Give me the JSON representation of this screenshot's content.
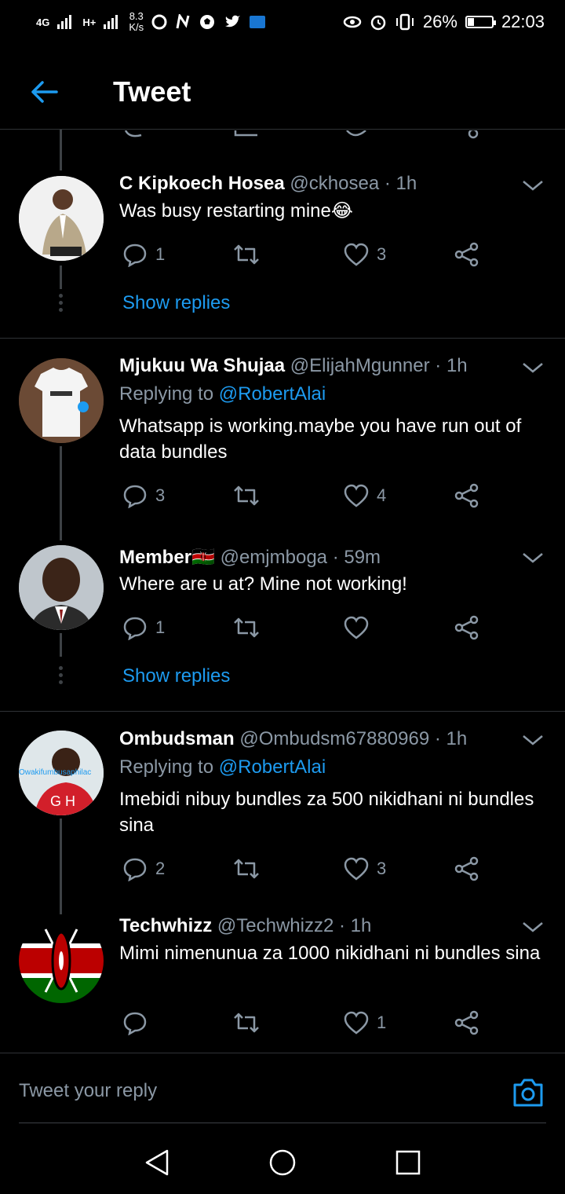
{
  "status_bar": {
    "network_1": "4G",
    "network_2": "H+",
    "speed_value": "8.3",
    "speed_unit": "K/s",
    "battery_percent": "26%",
    "battery_level": 0.26,
    "time": "22:03"
  },
  "header": {
    "title": "Tweet"
  },
  "tweets": [
    {
      "name": "C Kipkoech Hosea",
      "handle": "@ckhosea",
      "sep": "·",
      "time": "1h",
      "text": "Was busy restarting mine😂",
      "replies": "1",
      "retweets": "",
      "likes": "3",
      "show_replies": "Show replies"
    },
    {
      "name": "Mjukuu Wa Shujaa",
      "handle": "@ElijahMgunner",
      "sep": "·",
      "time": "1h",
      "replying_prefix": "Replying to",
      "replying_to": "@RobertAlai",
      "text": "Whatsapp is working.maybe you have run out of data bundles",
      "replies": "3",
      "retweets": "",
      "likes": "4"
    },
    {
      "name": "Member🇰🇪",
      "handle": "@emjmboga",
      "sep": "·",
      "time": "59m",
      "text": "Where are u at? Mine not working!",
      "replies": "1",
      "retweets": "",
      "likes": "",
      "show_replies": "Show replies"
    },
    {
      "name": "Ombudsman",
      "handle": "@Ombudsm67880969",
      "sep": "·",
      "time": "1h",
      "replying_prefix": "Replying to",
      "replying_to": "@RobertAlai",
      "text": "Imebidi nibuy bundles za 500 nikidhani ni bundles sina",
      "replies": "2",
      "retweets": "",
      "likes": "3",
      "avatar_text": "Owakifumbusaphilac"
    },
    {
      "name": "Techwhizz",
      "handle": "@Techwhizz2",
      "sep": "·",
      "time": "1h",
      "text": "Mimi nimenunua za 1000 nikidhani ni bundles sina",
      "replies": "",
      "retweets": "",
      "likes": "1"
    }
  ],
  "composer": {
    "placeholder": "Tweet your reply"
  },
  "colors": {
    "background": "#000000",
    "accent": "#1d9bf0",
    "muted": "#8b98a5",
    "divider": "#2f3336"
  },
  "icons": {
    "back": "arrow-left-icon",
    "chevron": "chevron-down-icon",
    "reply": "reply-bubble-icon",
    "retweet": "retweet-icon",
    "like": "heart-icon",
    "share": "share-icon",
    "camera": "camera-icon",
    "nav_back": "triangle-back-icon",
    "nav_home": "circle-home-icon",
    "nav_recent": "square-recent-icon"
  }
}
